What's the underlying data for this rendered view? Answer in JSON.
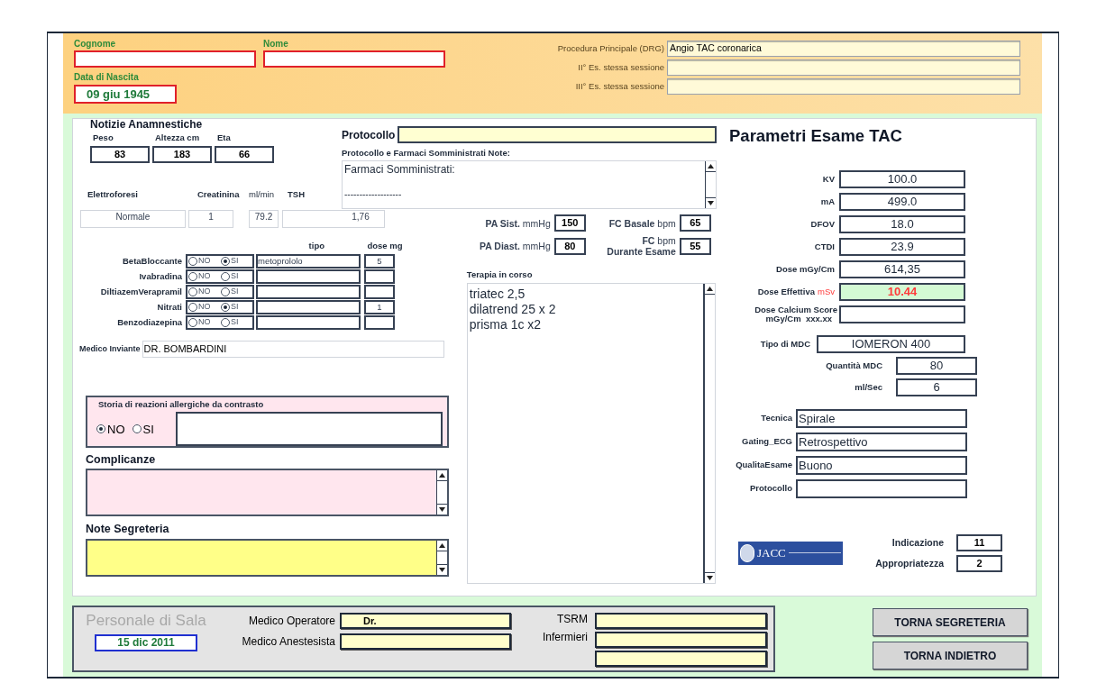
{
  "header": {
    "surname": {
      "label": "Cognome"
    },
    "first_name": {
      "label": "Nome"
    },
    "birth_date": {
      "label": "Data di Nascita",
      "value": "09 giu 1945"
    },
    "procedures": [
      {
        "label": "Procedura Principale (DRG)",
        "value": "Angio TAC coronarica"
      },
      {
        "label": "II° Es. stessa sessione"
      },
      {
        "label": "III° Es. stessa sessione"
      }
    ]
  },
  "anamnesis": {
    "title": "Notizie Anamnestiche",
    "measurements": [
      {
        "label": "Peso",
        "value": "83"
      },
      {
        "label": "Altezza cm",
        "value": "183"
      },
      {
        "label": "Eta",
        "value": "66"
      }
    ],
    "labs": {
      "labels": [
        "Elettroforesi",
        "Creatinina",
        "ml/min",
        "TSH"
      ],
      "values": [
        "Normale",
        "1",
        "79.2",
        "1,76"
      ]
    },
    "drug_headers": [
      "tipo",
      "dose mg"
    ],
    "drugs": [
      {
        "name": "BetaBloccante",
        "options": [
          {
            "label": "NO",
            "selected": false
          },
          {
            "label": "SI",
            "selected": true
          }
        ],
        "type": "metoprololo",
        "dose": "5"
      },
      {
        "name": "Ivabradina",
        "options": [
          {
            "label": "NO",
            "selected": false
          },
          {
            "label": "SI",
            "selected": false
          }
        ]
      },
      {
        "name": "DiltiazemVerapramil",
        "options": [
          {
            "label": "NO",
            "selected": false
          },
          {
            "label": "SI",
            "selected": false
          }
        ]
      },
      {
        "name": "Nitrati",
        "options": [
          {
            "label": "NO",
            "selected": false
          },
          {
            "label": "SI",
            "selected": true
          }
        ],
        "dose": "1"
      },
      {
        "name": "Benzodiazepina",
        "options": [
          {
            "label": "NO",
            "selected": false
          },
          {
            "label": "SI",
            "selected": false
          }
        ]
      }
    ],
    "referring_doctor": {
      "label": "Medico Inviante",
      "value": "DR. BOMBARDINI"
    },
    "allergies": {
      "title": "Storia di reazioni allergiche da contrasto",
      "options": [
        {
          "label": "NO",
          "selected": true
        },
        {
          "label": "SI",
          "selected": false
        }
      ]
    },
    "complications": {
      "label": "Complicanze"
    },
    "secretary_notes": {
      "label": "Note Segreteria"
    }
  },
  "protocol": {
    "label": "Protocollo",
    "notes_label": "Protocollo e Farmaci Somministrati Note:",
    "notes_lines": [
      "Farmaci Somministrati:",
      "-------------------"
    ]
  },
  "vitals": [
    {
      "label": "**PA Sist.** mmHg",
      "value": "150"
    },
    {
      "label": "**FC Basale** bpm",
      "value": "65"
    },
    {
      "label": "**PA Diast.** mmHg",
      "value": "80"
    },
    {
      "label": "**FC** bpm\n**Durante Esame**",
      "value": "55"
    }
  ],
  "therapy": {
    "label": "Terapia in corso",
    "lines": [
      "triatec 2,5",
      "dilatrend 25 x 2",
      "prisma 1c x2"
    ]
  },
  "exam": {
    "title": "Parametri Esame TAC",
    "params": [
      {
        "label": "KV",
        "value": "100.0",
        "highlighted": false
      },
      {
        "label": "mA",
        "value": "499.0",
        "highlighted": false
      },
      {
        "label": "DFOV",
        "value": "18.0",
        "highlighted": false
      },
      {
        "label": "CTDI",
        "value": "23.9",
        "highlighted": false
      },
      {
        "label": "Dose mGy/Cm",
        "value": "614,35",
        "highlighted": false
      },
      {
        "label": "Dose Effettiva",
        "unit": "mSv",
        "value": "10.44",
        "highlighted": true
      },
      {
        "label": "Dose Calcium Score",
        "label2": "mGy/Cm  xxx.xx",
        "highlighted": false
      }
    ],
    "contrast": [
      {
        "label": "Tipo di MDC",
        "value": "IOMERON 400"
      },
      {
        "label": "Quantità MDC",
        "value": "80"
      },
      {
        "label": "ml/Sec",
        "value": "6"
      }
    ],
    "technique": [
      {
        "label": "Tecnica",
        "value": "Spirale"
      },
      {
        "label": "Gating_ECG",
        "value": "Retrospettivo"
      },
      {
        "label": "QualitaEsame",
        "value": "Buono"
      },
      {
        "label": "Protocollo"
      }
    ],
    "logo_text": "JACC",
    "scores": [
      {
        "label": "Indicazione",
        "value": "11"
      },
      {
        "label": "Appropriatezza",
        "value": "2"
      }
    ]
  },
  "staff": {
    "title": "Personale di Sala",
    "date": "15 dic 2011",
    "doctors": [
      {
        "label": "Medico Operatore",
        "value": "Dr."
      },
      {
        "label": "Medico Anestesista"
      }
    ],
    "tsrm_label": "TSRM",
    "nurses_label": "Infermieri"
  },
  "buttons": [
    "TORNA SEGRETERIA",
    "TORNA INDIETRO"
  ]
}
